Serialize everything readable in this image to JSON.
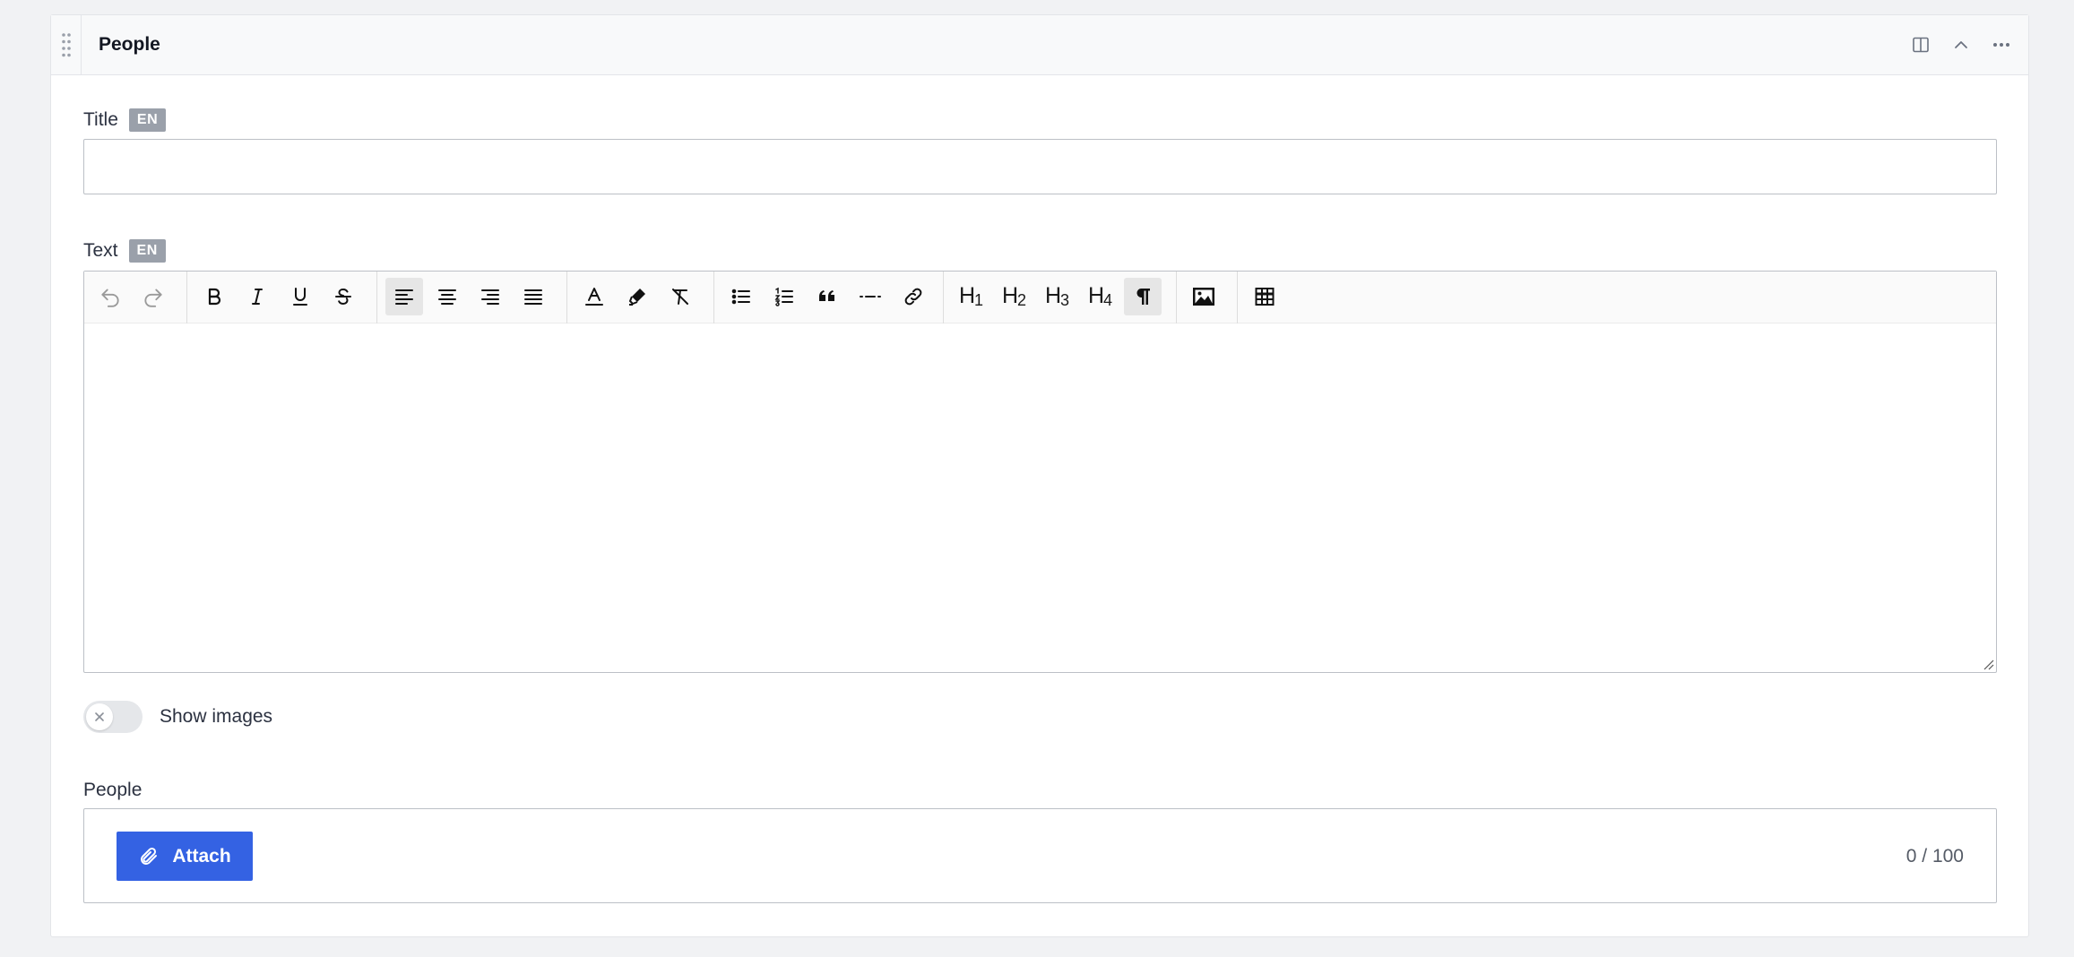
{
  "panel": {
    "title": "People"
  },
  "fields": {
    "title": {
      "label": "Title",
      "lang": "EN",
      "value": "",
      "placeholder": ""
    },
    "text": {
      "label": "Text",
      "lang": "EN"
    }
  },
  "toolbar": {
    "buttons": [
      {
        "name": "undo",
        "icon": "undo-icon"
      },
      {
        "name": "redo",
        "icon": "redo-icon"
      },
      {
        "name": "bold",
        "icon": "bold-icon"
      },
      {
        "name": "italic",
        "icon": "italic-icon"
      },
      {
        "name": "underline",
        "icon": "underline-icon"
      },
      {
        "name": "strikethrough",
        "icon": "strikethrough-icon"
      },
      {
        "name": "align-left",
        "icon": "align-left-icon",
        "active": true
      },
      {
        "name": "align-center",
        "icon": "align-center-icon"
      },
      {
        "name": "align-right",
        "icon": "align-right-icon"
      },
      {
        "name": "align-justify",
        "icon": "align-justify-icon"
      },
      {
        "name": "text-color",
        "icon": "text-color-icon"
      },
      {
        "name": "highlight",
        "icon": "highlighter-icon"
      },
      {
        "name": "clear-format",
        "icon": "clear-format-icon"
      },
      {
        "name": "bullet-list",
        "icon": "bullet-list-icon"
      },
      {
        "name": "ordered-list",
        "icon": "ordered-list-icon"
      },
      {
        "name": "blockquote",
        "icon": "quote-icon"
      },
      {
        "name": "horizontal-rule",
        "icon": "horizontal-rule-icon"
      },
      {
        "name": "link",
        "icon": "link-icon"
      },
      {
        "name": "heading-1",
        "icon": "heading-1-icon"
      },
      {
        "name": "heading-2",
        "icon": "heading-2-icon"
      },
      {
        "name": "heading-3",
        "icon": "heading-3-icon"
      },
      {
        "name": "heading-4",
        "icon": "heading-4-icon"
      },
      {
        "name": "paragraph",
        "icon": "paragraph-icon",
        "active": true
      },
      {
        "name": "image",
        "icon": "image-icon"
      },
      {
        "name": "table",
        "icon": "table-icon"
      }
    ]
  },
  "show_images": {
    "label": "Show images",
    "enabled": false
  },
  "people": {
    "label": "People",
    "attach_label": "Attach",
    "count": "0 / 100"
  },
  "colors": {
    "accent": "#3462e3",
    "badge": "#9aa0aa",
    "page_bg": "#f1f2f4"
  }
}
